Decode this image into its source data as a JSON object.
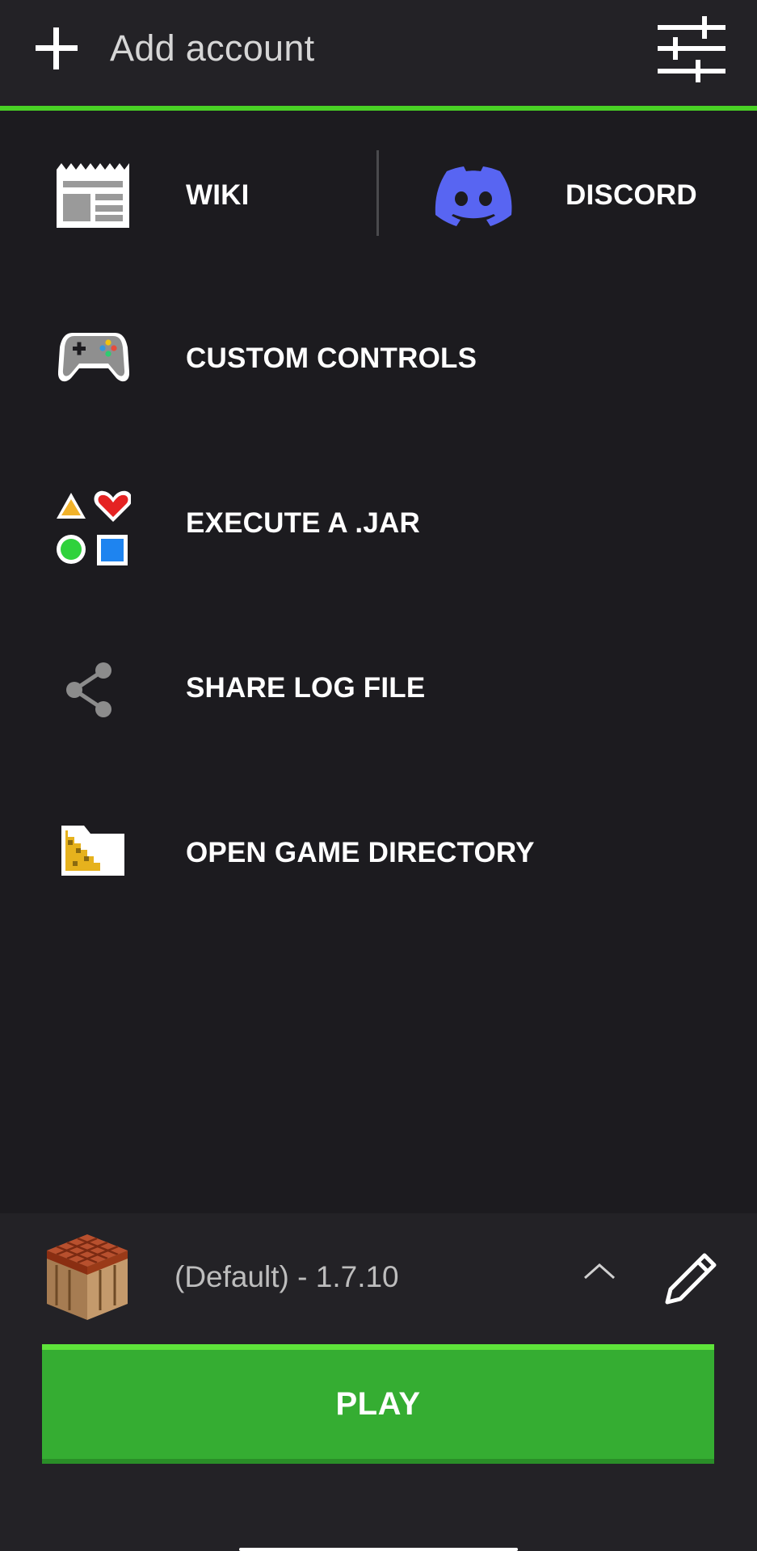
{
  "header": {
    "add_account_label": "Add account",
    "add_icon": "plus-icon",
    "settings_icon": "sliders-icon",
    "accent_color": "#49d125"
  },
  "links": {
    "wiki": {
      "label": "WIKI",
      "icon": "newspaper-icon"
    },
    "discord": {
      "label": "DISCORD",
      "icon": "discord-icon",
      "color": "#5865f2"
    }
  },
  "menu": [
    {
      "label": "CUSTOM CONTROLS",
      "icon": "gamepad-icon"
    },
    {
      "label": "EXECUTE A .JAR",
      "icon": "shapes-icon"
    },
    {
      "label": "SHARE LOG FILE",
      "icon": "share-icon"
    },
    {
      "label": "OPEN GAME DIRECTORY",
      "icon": "folder-icon"
    }
  ],
  "profile": {
    "version_label": "(Default) - 1.7.10",
    "icon": "crafting-table-icon",
    "expand_icon": "chevron-up-icon",
    "edit_icon": "pencil-icon"
  },
  "play": {
    "label": "PLAY",
    "color": "#35ad32"
  }
}
